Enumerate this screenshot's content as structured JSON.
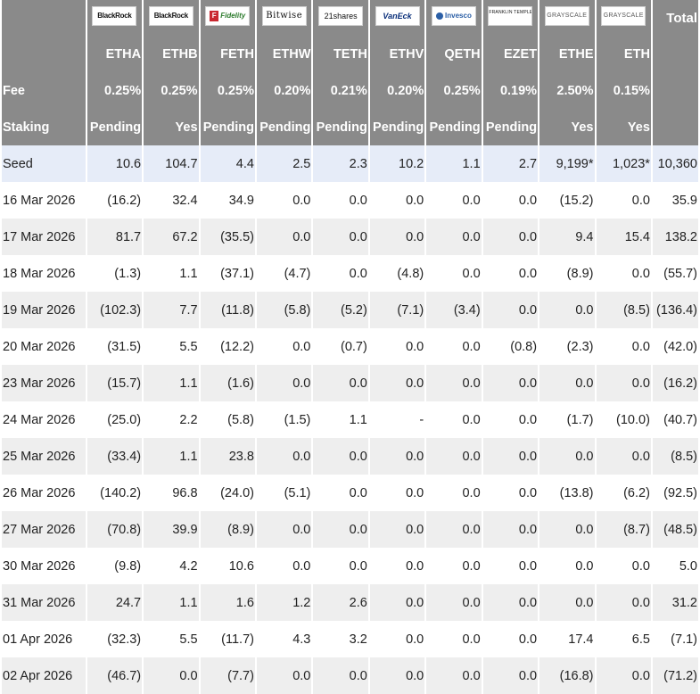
{
  "header": {
    "total_label": "Total",
    "funds": [
      {
        "issuer": "BlackRock",
        "ticker": "ETHA",
        "fee": "0.25%",
        "staking": "Pending",
        "logo_class": "br"
      },
      {
        "issuer": "BlackRock",
        "ticker": "ETHB",
        "fee": "0.25%",
        "staking": "Yes",
        "logo_class": "br"
      },
      {
        "issuer": "Fidelity",
        "ticker": "FETH",
        "fee": "0.25%",
        "staking": "Pending",
        "logo_class": "fid"
      },
      {
        "issuer": "Bitwise",
        "ticker": "ETHW",
        "fee": "0.20%",
        "staking": "Pending",
        "logo_class": "bw"
      },
      {
        "issuer": "21shares",
        "ticker": "TETH",
        "fee": "0.21%",
        "staking": "Pending",
        "logo_class": "sh"
      },
      {
        "issuer": "VanEck",
        "ticker": "ETHV",
        "fee": "0.20%",
        "staking": "Pending",
        "logo_class": "ve"
      },
      {
        "issuer": "Invesco",
        "ticker": "QETH",
        "fee": "0.25%",
        "staking": "Pending",
        "logo_class": "iv"
      },
      {
        "issuer": "FRANKLIN TEMPLETON",
        "ticker": "EZET",
        "fee": "0.19%",
        "staking": "Pending",
        "logo_class": "ft"
      },
      {
        "issuer": "GRAYSCALE",
        "ticker": "ETHE",
        "fee": "2.50%",
        "staking": "Yes",
        "logo_class": "gs"
      },
      {
        "issuer": "GRAYSCALE",
        "ticker": "ETH",
        "fee": "0.15%",
        "staking": "Yes",
        "logo_class": "gs"
      }
    ],
    "fee_label": "Fee",
    "staking_label": "Staking"
  },
  "rows": [
    {
      "label": "Seed",
      "values": [
        "10.6",
        "104.7",
        "4.4",
        "2.5",
        "2.3",
        "10.2",
        "1.1",
        "2.7",
        "9,199*",
        "1,023*"
      ],
      "total": "10,360"
    },
    {
      "label": "16 Mar 2026",
      "values": [
        "(16.2)",
        "32.4",
        "34.9",
        "0.0",
        "0.0",
        "0.0",
        "0.0",
        "0.0",
        "(15.2)",
        "0.0"
      ],
      "total": "35.9"
    },
    {
      "label": "17 Mar 2026",
      "values": [
        "81.7",
        "67.2",
        "(35.5)",
        "0.0",
        "0.0",
        "0.0",
        "0.0",
        "0.0",
        "9.4",
        "15.4"
      ],
      "total": "138.2"
    },
    {
      "label": "18 Mar 2026",
      "values": [
        "(1.3)",
        "1.1",
        "(37.1)",
        "(4.7)",
        "0.0",
        "(4.8)",
        "0.0",
        "0.0",
        "(8.9)",
        "0.0"
      ],
      "total": "(55.7)"
    },
    {
      "label": "19 Mar 2026",
      "values": [
        "(102.3)",
        "7.7",
        "(11.8)",
        "(5.8)",
        "(5.2)",
        "(7.1)",
        "(3.4)",
        "0.0",
        "0.0",
        "(8.5)"
      ],
      "total": "(136.4)"
    },
    {
      "label": "20 Mar 2026",
      "values": [
        "(31.5)",
        "5.5",
        "(12.2)",
        "0.0",
        "(0.7)",
        "0.0",
        "0.0",
        "(0.8)",
        "(2.3)",
        "0.0"
      ],
      "total": "(42.0)"
    },
    {
      "label": "23 Mar 2026",
      "values": [
        "(15.7)",
        "1.1",
        "(1.6)",
        "0.0",
        "0.0",
        "0.0",
        "0.0",
        "0.0",
        "0.0",
        "0.0"
      ],
      "total": "(16.2)"
    },
    {
      "label": "24 Mar 2026",
      "values": [
        "(25.0)",
        "2.2",
        "(5.8)",
        "(1.5)",
        "1.1",
        "-",
        "0.0",
        "0.0",
        "(1.7)",
        "(10.0)"
      ],
      "total": "(40.7)"
    },
    {
      "label": "25 Mar 2026",
      "values": [
        "(33.4)",
        "1.1",
        "23.8",
        "0.0",
        "0.0",
        "0.0",
        "0.0",
        "0.0",
        "0.0",
        "0.0"
      ],
      "total": "(8.5)"
    },
    {
      "label": "26 Mar 2026",
      "values": [
        "(140.2)",
        "96.8",
        "(24.0)",
        "(5.1)",
        "0.0",
        "0.0",
        "0.0",
        "0.0",
        "(13.8)",
        "(6.2)"
      ],
      "total": "(92.5)"
    },
    {
      "label": "27 Mar 2026",
      "values": [
        "(70.8)",
        "39.9",
        "(8.9)",
        "0.0",
        "0.0",
        "0.0",
        "0.0",
        "0.0",
        "0.0",
        "(8.7)"
      ],
      "total": "(48.5)"
    },
    {
      "label": "30 Mar 2026",
      "values": [
        "(9.8)",
        "4.2",
        "10.6",
        "0.0",
        "0.0",
        "0.0",
        "0.0",
        "0.0",
        "0.0",
        "0.0"
      ],
      "total": "5.0"
    },
    {
      "label": "31 Mar 2026",
      "values": [
        "24.7",
        "1.1",
        "1.6",
        "1.2",
        "2.6",
        "0.0",
        "0.0",
        "0.0",
        "0.0",
        "0.0"
      ],
      "total": "31.2"
    },
    {
      "label": "01 Apr 2026",
      "values": [
        "(32.3)",
        "5.5",
        "(11.7)",
        "4.3",
        "3.2",
        "0.0",
        "0.0",
        "0.0",
        "17.4",
        "6.5"
      ],
      "total": "(7.1)"
    },
    {
      "label": "02 Apr 2026",
      "values": [
        "(46.7)",
        "0.0",
        "(7.7)",
        "0.0",
        "0.0",
        "0.0",
        "0.0",
        "0.0",
        "(16.8)",
        "0.0"
      ],
      "total": "(71.2)"
    }
  ],
  "colors": {
    "header_bg": "#8a8a8a",
    "negative": "#cc2222",
    "seed_bg": "#e6ecf8",
    "alt_row_bg": "#eeeeee"
  }
}
